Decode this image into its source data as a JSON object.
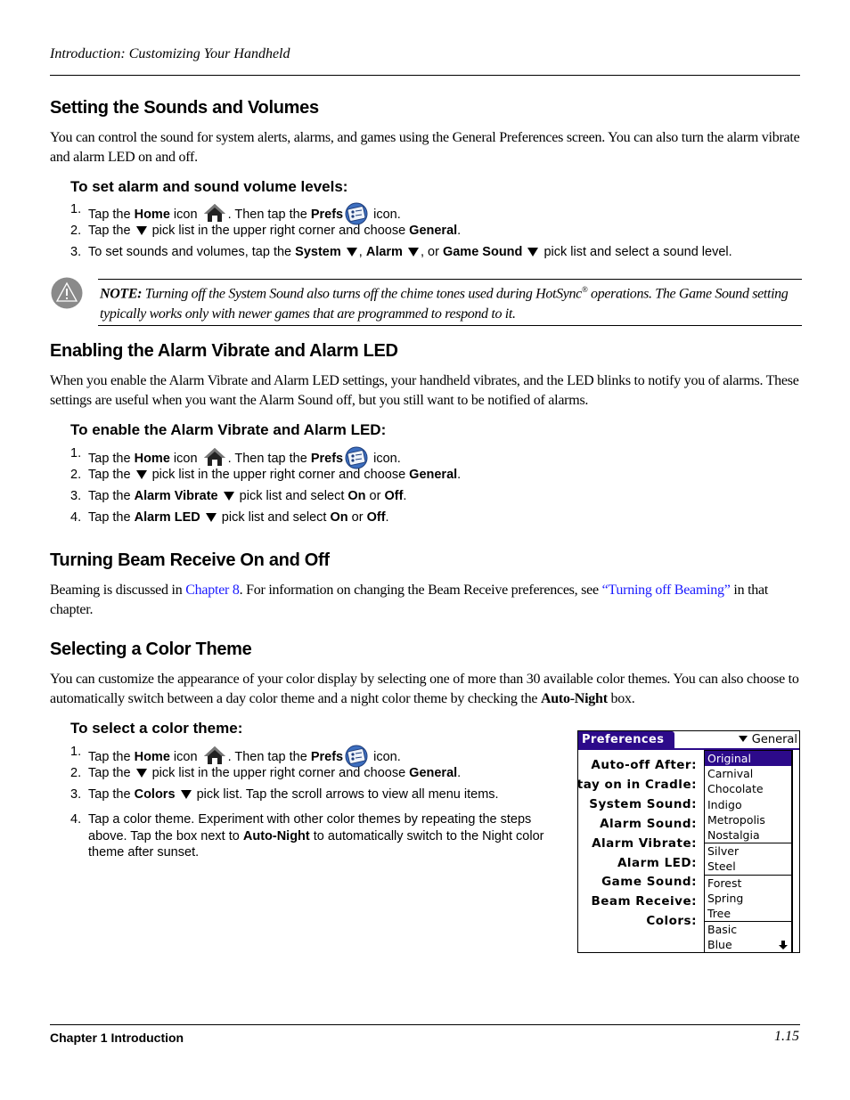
{
  "header": {
    "running_head": "Introduction: Customizing Your Handheld"
  },
  "icons": {
    "home": "home-icon",
    "prefs": "prefs-icon",
    "picklist": "down-triangle-icon",
    "note": "warning-icon"
  },
  "sections": {
    "sounds": {
      "title": "Setting the Sounds and Volumes",
      "intro": "You can control the sound for system alerts, alarms, and games using the General Preferences screen. You can also turn the alarm vibrate and alarm LED on and off.",
      "procedure_title": "To set alarm and sound volume levels:",
      "steps": [
        {
          "num": "1.",
          "a": "Tap the ",
          "b1": "Home",
          "c": " icon ",
          "d": ". Then tap the ",
          "b2": "Prefs",
          "e": " icon."
        },
        {
          "num": "2.",
          "a": "Tap the ",
          "c": " pick list in the upper right corner and choose ",
          "b1": "General",
          "e": "."
        },
        {
          "num": "3.",
          "a": "To set sounds and volumes, tap the ",
          "b1": "System",
          "c": ", ",
          "b2": "Alarm",
          "d": ", or ",
          "b3": "Game Sound",
          "e": " pick list and select a sound level."
        }
      ],
      "note": {
        "label": "NOTE:",
        "text1": " Turning off the System Sound also turns off the chime tones used during HotSync",
        "reg": "®",
        "text2": " operations. The Game Sound setting typically works only with newer games that are programmed to respond to it."
      }
    },
    "vibrate": {
      "title": "Enabling the Alarm Vibrate and Alarm LED",
      "intro": "When you enable the Alarm Vibrate and Alarm LED settings, your handheld vibrates, and the LED blinks to notify you of alarms. These settings are useful when you want the Alarm Sound off, but you still want to be notified of alarms.",
      "procedure_title": "To enable the Alarm Vibrate and Alarm LED:",
      "steps": [
        {
          "num": "1.",
          "a": "Tap the ",
          "b1": "Home",
          "c": " icon ",
          "d": ". Then tap the ",
          "b2": "Prefs",
          "e": " icon."
        },
        {
          "num": "2.",
          "a": "Tap the ",
          "c": " pick list in the upper right corner and choose ",
          "b1": "General",
          "e": "."
        },
        {
          "num": "3.",
          "a": "Tap the ",
          "b1": "Alarm Vibrate",
          "c": " pick list and select ",
          "b2": "On",
          "d": " or ",
          "b3": "Off",
          "e": "."
        },
        {
          "num": "4.",
          "a": "Tap the ",
          "b1": "Alarm LED",
          "c": " pick list and select ",
          "b2": "On",
          "d": " or ",
          "b3": "Off",
          "e": "."
        }
      ]
    },
    "beam": {
      "title": "Turning Beam Receive On and Off",
      "t1": "Beaming is discussed in ",
      "link1": "Chapter 8",
      "t2": ". For information on changing the Beam Receive preferences, see ",
      "link2": "“Turning off Beaming”",
      "t3": " in that chapter."
    },
    "color": {
      "title": "Selecting a Color Theme",
      "intro1": "You can customize the appearance of your color display by selecting one of more than 30 available color themes. You can also choose to automatically switch between a day color theme and a night color theme by checking the ",
      "intro_bold": "Auto-Night",
      "intro2": " box.",
      "procedure_title": "To select a color theme:",
      "steps": [
        {
          "num": "1.",
          "a": "Tap the ",
          "b1": "Home",
          "c": " icon ",
          "d": ". Then tap the ",
          "b2": "Prefs",
          "e": " icon."
        },
        {
          "num": "2.",
          "a": "Tap the ",
          "c": " pick list in the upper right corner and choose ",
          "b1": "General",
          "e": "."
        },
        {
          "num": "3.",
          "a": "Tap the ",
          "b1": "Colors",
          "c": " pick list. Tap the scroll arrows to view all menu items."
        },
        {
          "num": "4.",
          "a": "Tap a color theme. Experiment with other color themes by repeating the steps above. Tap the box next to ",
          "b1": "Auto-Night",
          "c": " to automatically switch to the Night color theme after sunset."
        }
      ]
    }
  },
  "screenshot": {
    "title": "Preferences",
    "category": "General",
    "accent_color": "#2c0a8a",
    "labels": [
      "Auto-off After:",
      "Stay on in Cradle:",
      "System Sound:",
      "Alarm Sound:",
      "Alarm Vibrate:",
      "Alarm LED:",
      "Game Sound:",
      "Beam Receive:",
      "Colors:"
    ],
    "themes": [
      "Original",
      "Carnival",
      "Chocolate",
      "Indigo",
      "Metropolis",
      "Nostalgia",
      "Silver",
      "Steel",
      "Forest",
      "Spring",
      "Tree",
      "Basic",
      "Blue"
    ],
    "selected_theme": "Original",
    "scroll_arrow": "down-arrow-icon"
  },
  "footer": {
    "chapter": "Chapter 1 Introduction",
    "page": "1.15"
  }
}
